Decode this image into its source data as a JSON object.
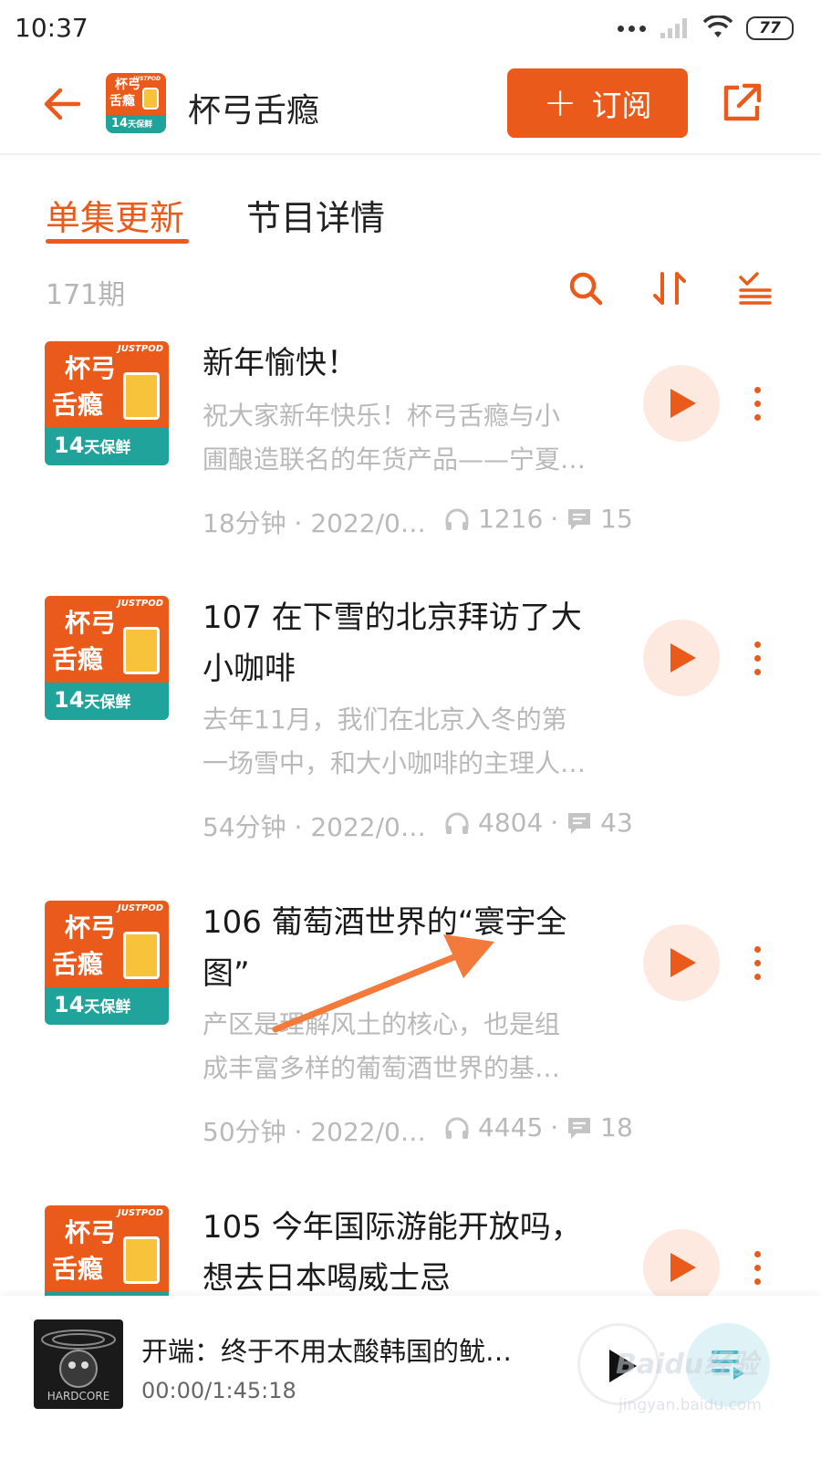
{
  "status_bar": {
    "time": "10:37",
    "battery": "77"
  },
  "header": {
    "podcast_name": "杯弓舌瘾",
    "subscribe_label": "订阅",
    "cover": {
      "line1": "杯弓",
      "line2": "舌瘾",
      "footer_num": "14",
      "footer_text": "天保鲜",
      "brand": "JUSTPOD"
    }
  },
  "tabs": [
    {
      "label": "单集更新",
      "active": true
    },
    {
      "label": "节目详情",
      "active": false
    }
  ],
  "episode_count": "171期",
  "episodes": [
    {
      "title_lines": [
        "新年愉快！"
      ],
      "desc_lines": [
        "祝大家新年快乐！杯弓舌瘾与小",
        "圃酿造联名的年货产品——宁夏…"
      ],
      "duration_date": "18分钟 · 2022/0…",
      "plays": "1216",
      "comments": "15"
    },
    {
      "title_lines": [
        "107 在下雪的北京拜访了大",
        "小咖啡"
      ],
      "desc_lines": [
        "去年11月，我们在北京入冬的第",
        "一场雪中，和大小咖啡的主理人…"
      ],
      "duration_date": "54分钟 · 2022/0…",
      "plays": "4804",
      "comments": "43"
    },
    {
      "title_lines": [
        "106 葡萄酒世界的“寰宇全",
        "图”"
      ],
      "desc_lines": [
        "产区是理解风土的核心，也是组",
        "成丰富多样的葡萄酒世界的基…"
      ],
      "duration_date": "50分钟 · 2022/0…",
      "plays": "4445",
      "comments": "18"
    },
    {
      "title_lines": [
        "105 今年国际游能开放吗，",
        "想去日本喝威士忌"
      ],
      "desc_lines": [],
      "duration_date": "",
      "plays": "",
      "comments": ""
    }
  ],
  "mini_player": {
    "title": "开端：终于不用太酸韩国的鱿…",
    "time": "00:00/1:45:18",
    "cover_text": "HARDCORE"
  },
  "watermark": {
    "line1": "Baidu经验",
    "line2": "jingyan.baidu.com"
  },
  "colors": {
    "accent": "#ea5a1a",
    "teal": "#20a39a",
    "muted": "#b9b9b9",
    "play_bg": "#fde9df"
  },
  "icons": [
    "back-arrow-icon",
    "share-icon",
    "search-icon",
    "sort-icon",
    "filter-list-icon",
    "play-icon",
    "more-vertical-icon",
    "headphones-icon",
    "comment-icon",
    "playlist-icon"
  ]
}
